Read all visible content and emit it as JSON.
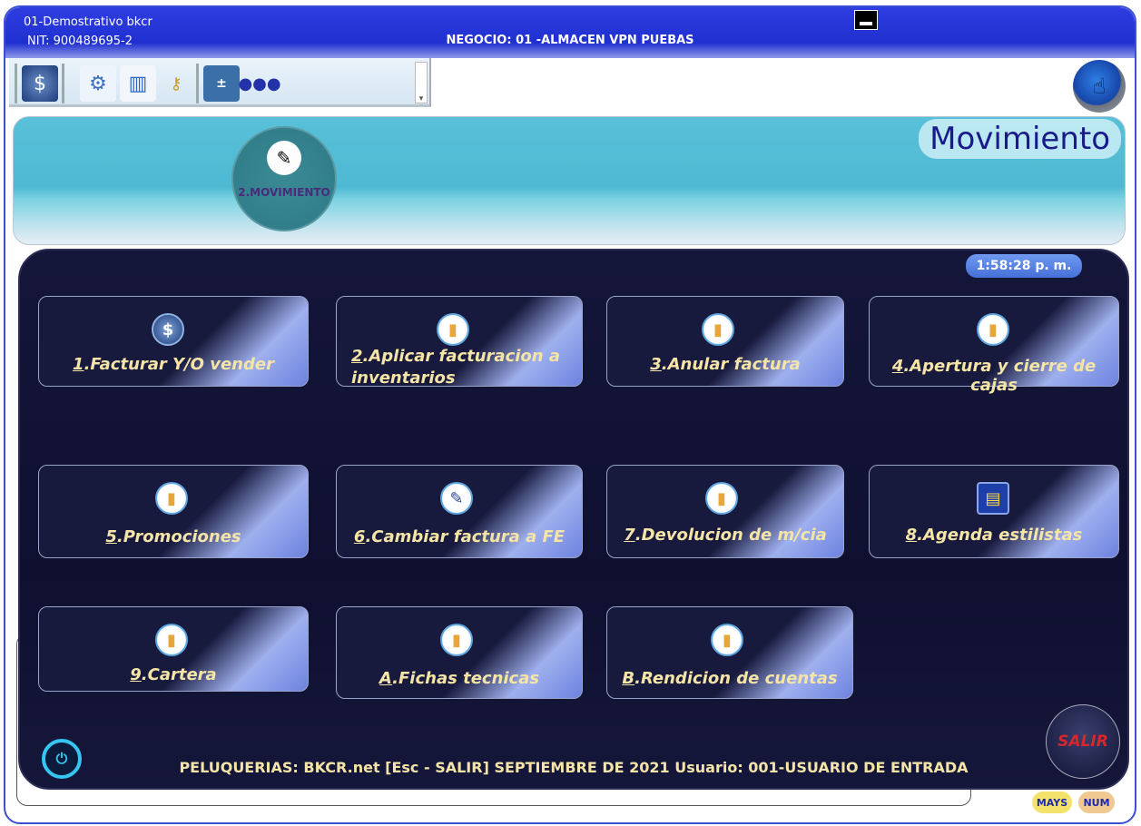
{
  "titlebar": {
    "company": "01-Demostrativo bkcr",
    "nit": "NIT: 900489695-2",
    "negocio": "NEGOCIO: 01   -ALMACEN VPN PUEBAS"
  },
  "toolbar": {
    "icons": [
      "money-bag-icon",
      "gear-icon",
      "chart-icon",
      "key-icon",
      "calculator-icon",
      "users-icon"
    ]
  },
  "banner": {
    "title": "Movimiento",
    "bubble_label": "2.MOVIMIENTO"
  },
  "panel": {
    "clock": "1:58:28 p. m.",
    "tiles": [
      {
        "key": "1",
        "label": ".Facturar Y/O vender",
        "icon": "money-bag-icon"
      },
      {
        "key": "2",
        "label": ".Aplicar facturacion a inventarios",
        "icon": "folder-icon"
      },
      {
        "key": "3",
        "label": ".Anular factura",
        "icon": "folder-icon"
      },
      {
        "key": "4",
        "label": ".Apertura y cierre de cajas",
        "icon": "folder-icon"
      },
      {
        "key": "5",
        "label": ".Promociones",
        "icon": "folder-icon"
      },
      {
        "key": "6",
        "label": ".Cambiar factura a FE",
        "icon": "edit-document-icon"
      },
      {
        "key": "7",
        "label": ".Devolucion de m/cia",
        "icon": "folder-icon"
      },
      {
        "key": "8",
        "label": ".Agenda estilistas",
        "icon": "agenda-icon"
      },
      {
        "key": "9",
        "label": ".Cartera",
        "icon": "folder-icon"
      },
      {
        "key": "A",
        "label": ".Fichas tecnicas",
        "icon": "folder-icon"
      },
      {
        "key": "B",
        "label": ".Rendicion de cuentas",
        "icon": "folder-icon"
      }
    ],
    "footer": "PELUQUERIAS: BKCR.net    [Esc - SALIR]    SEPTIEMBRE DE 2021    Usuario:  001-USUARIO DE ENTRADA",
    "exit_label": "SALIR"
  },
  "status": {
    "caps": "MAYS",
    "num": "NUM"
  }
}
